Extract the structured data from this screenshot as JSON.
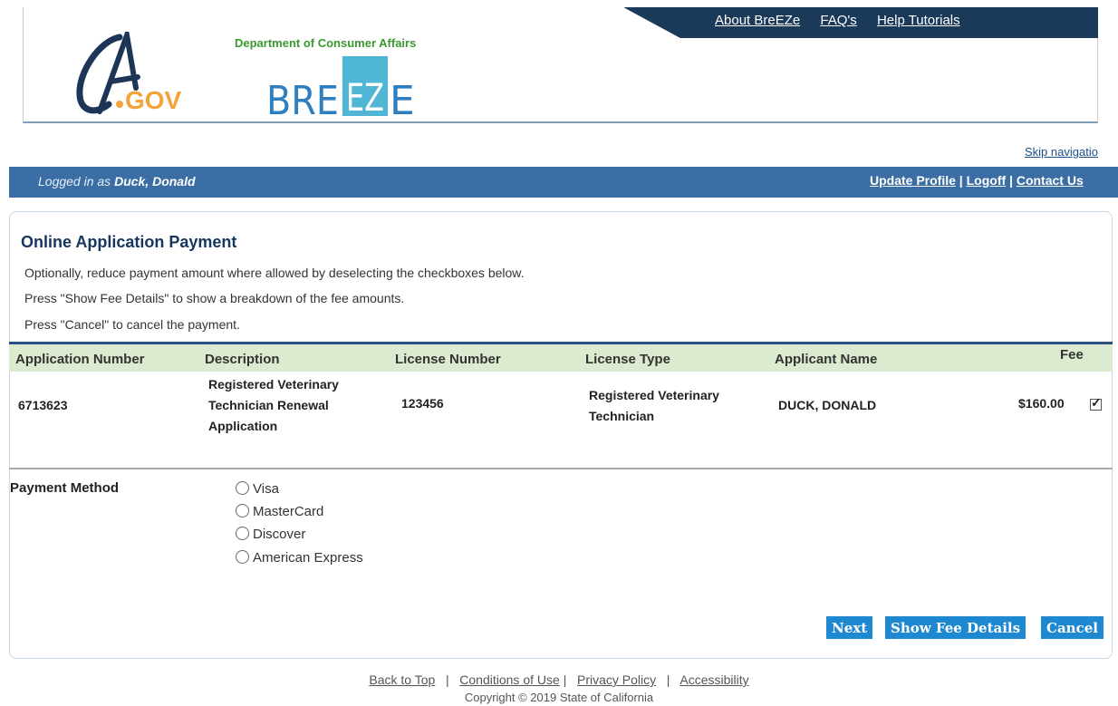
{
  "header": {
    "links": [
      "About BreEZe",
      "FAQ's",
      "Help Tutorials"
    ],
    "ca_logo_text": "CA.GOV",
    "dca_text": "Department of Consumer Affairs",
    "breeze_logo_text": "BREEZE"
  },
  "skip_nav": "Skip navigatio",
  "login_bar": {
    "prefix": "Logged in as",
    "user": "Duck, Donald",
    "update_profile": "Update Profile",
    "logoff": "Logoff",
    "contact_us": "Contact Us"
  },
  "page": {
    "title": "Online Application Payment",
    "instructions": [
      "Optionally, reduce payment amount where allowed by deselecting the checkboxes below.",
      "Press \"Show Fee Details\" to show a breakdown of the fee amounts.",
      "Press \"Cancel\" to cancel the payment."
    ]
  },
  "table": {
    "headers": [
      "Application Number",
      "Description",
      "License Number",
      "License Type",
      "Applicant Name",
      "Fee"
    ],
    "row": {
      "application_number": "6713623",
      "description": [
        "Registered Veterinary",
        "Technician Renewal",
        "Application"
      ],
      "license_number": "123456",
      "license_type": [
        "Registered Veterinary",
        "Technician"
      ],
      "applicant_name": "DUCK, DONALD",
      "fee": "$160.00",
      "selected": true
    }
  },
  "payment": {
    "label": "Payment Method",
    "options": [
      "Visa",
      "MasterCard",
      "Discover",
      "American Express"
    ]
  },
  "buttons": {
    "next": "Next",
    "show_fee_details": "Show Fee Details",
    "cancel": "Cancel"
  },
  "footer": {
    "links": [
      "Back to Top",
      "Conditions of Use",
      "Privacy Policy",
      "Accessibility"
    ],
    "copyright": "Copyright © 2019 State of California"
  },
  "colors": {
    "nav_dark": "#1b3a5a",
    "login_bar": "#3a6ea5",
    "table_header": "#dcebd0",
    "button": "#1e88d0",
    "title": "#15365f",
    "dca_green": "#3a9a2f",
    "breeze_blue": "#2d7fc1",
    "breeze_tile": "#4fb6d6",
    "ca_navy": "#1d3557",
    "ca_orange": "#f2a43a"
  }
}
